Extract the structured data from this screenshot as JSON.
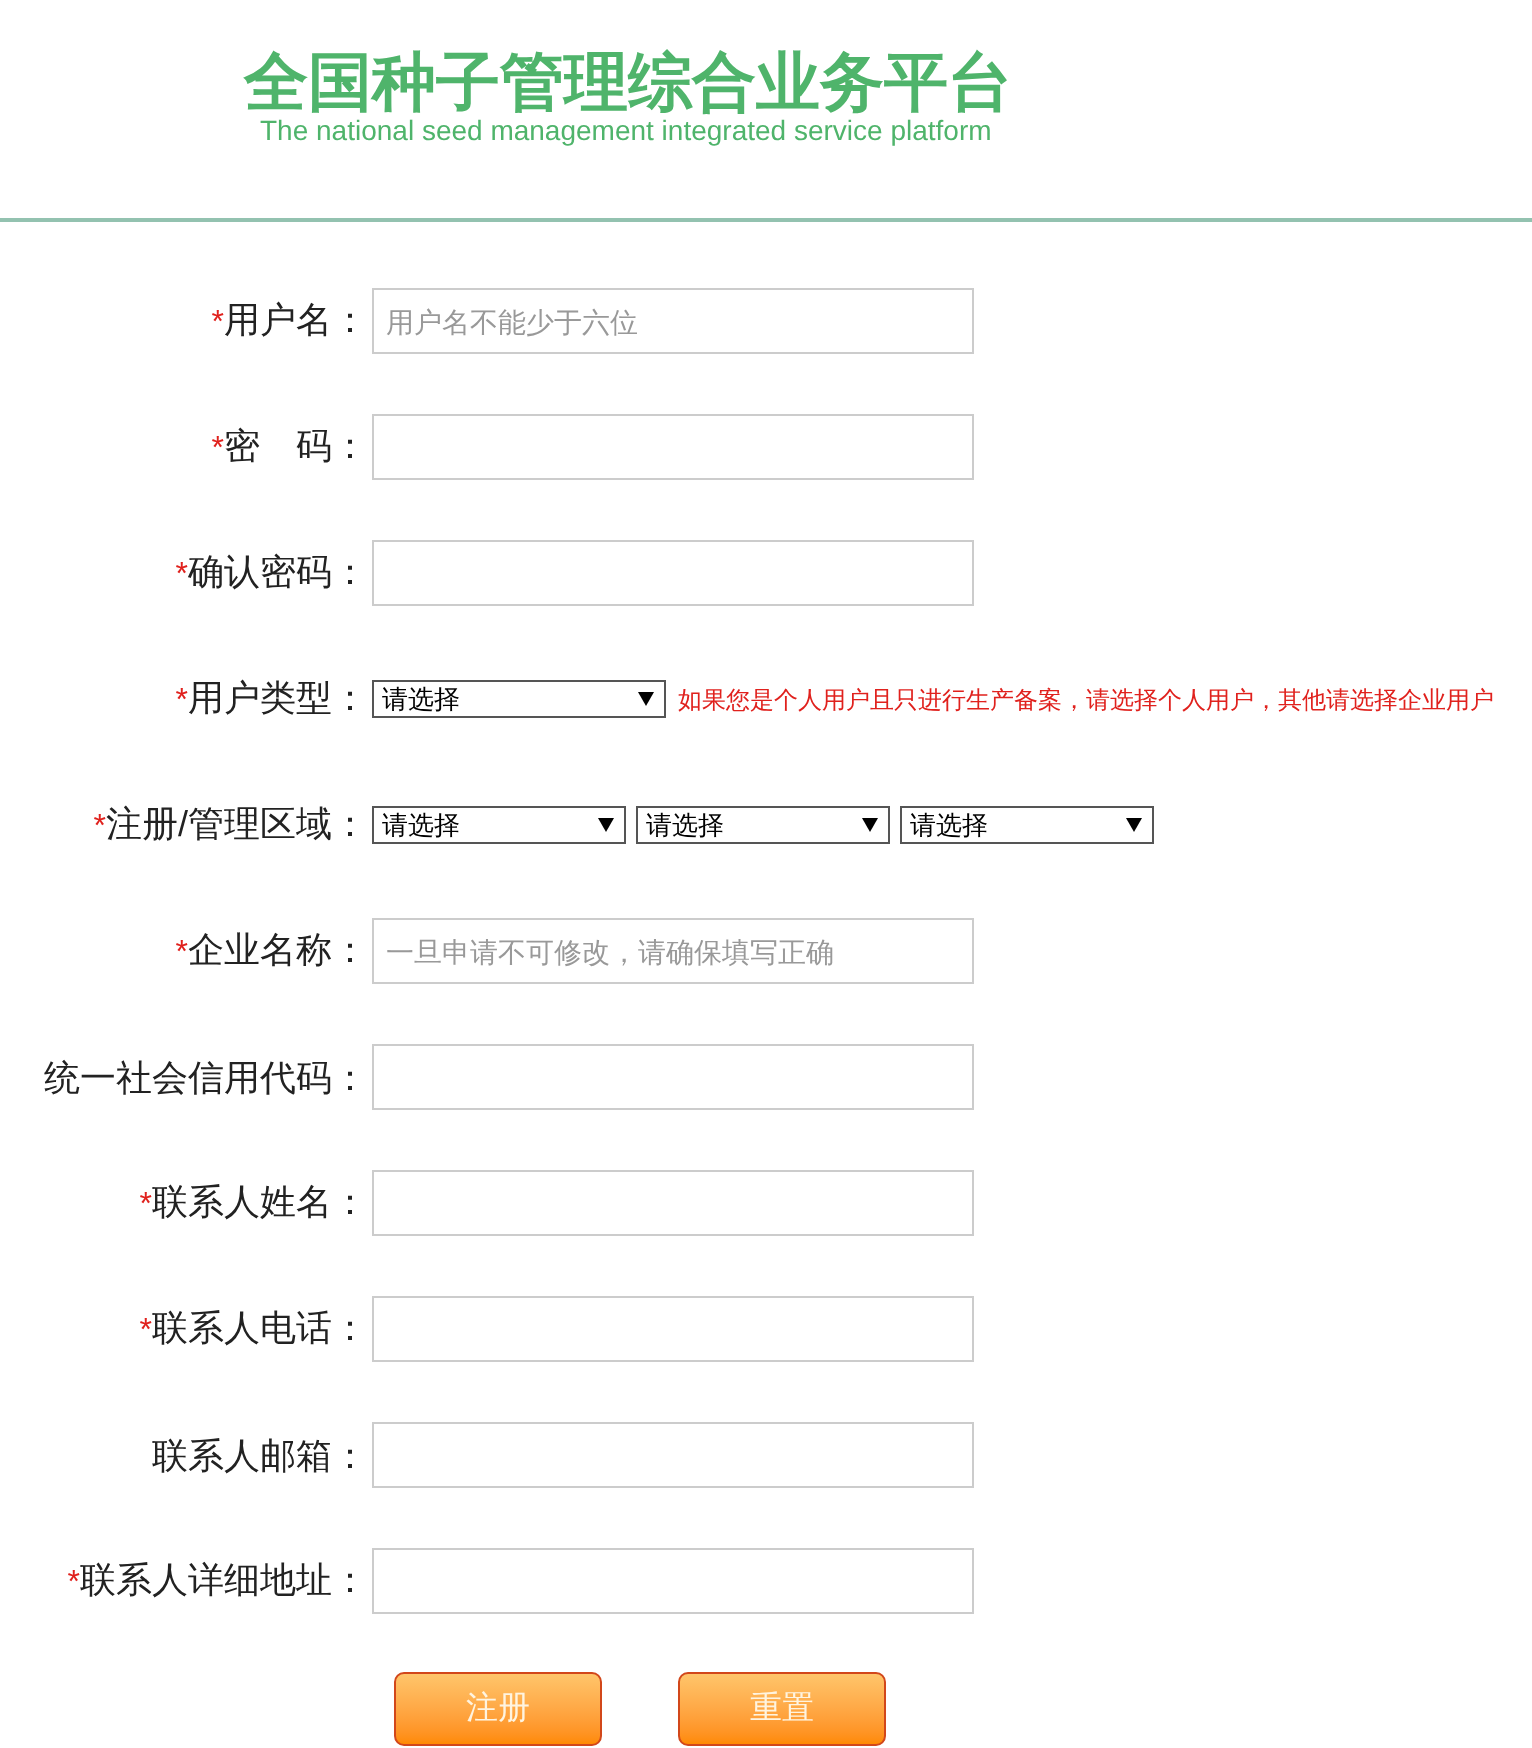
{
  "header": {
    "title": "全国种子管理综合业务平台",
    "subtitle": "The national seed management integrated service platform"
  },
  "form": {
    "fields": [
      {
        "kind": "input",
        "required_mark": "*",
        "label": "用户名：",
        "placeholder": "用户名不能少于六位"
      },
      {
        "kind": "input",
        "required_mark": "*",
        "label": "密　码："
      },
      {
        "kind": "input",
        "required_mark": "*",
        "label": "确认密码："
      },
      {
        "kind": "select",
        "required_mark": "*",
        "label": "用户类型：",
        "selects": [
          "请选择"
        ],
        "hint": "如果您是个人用户且只进行生产备案，请选择个人用户，其他请选择企业用户"
      },
      {
        "kind": "select",
        "required_mark": "*",
        "label": "注册/管理区域：",
        "selects": [
          "请选择",
          "请选择",
          "请选择"
        ]
      },
      {
        "kind": "input",
        "required_mark": "*",
        "label": "企业名称：",
        "placeholder": "一旦申请不可修改，请确保填写正确"
      },
      {
        "kind": "input",
        "label": "统一社会信用代码："
      },
      {
        "kind": "input",
        "required_mark": "*",
        "label": "联系人姓名："
      },
      {
        "kind": "input",
        "required_mark": "*",
        "label": "联系人电话："
      },
      {
        "kind": "input",
        "label": "联系人邮箱："
      },
      {
        "kind": "input",
        "required_mark": "*",
        "label": "联系人详细地址："
      }
    ],
    "buttons": [
      "注册",
      "重置"
    ]
  }
}
